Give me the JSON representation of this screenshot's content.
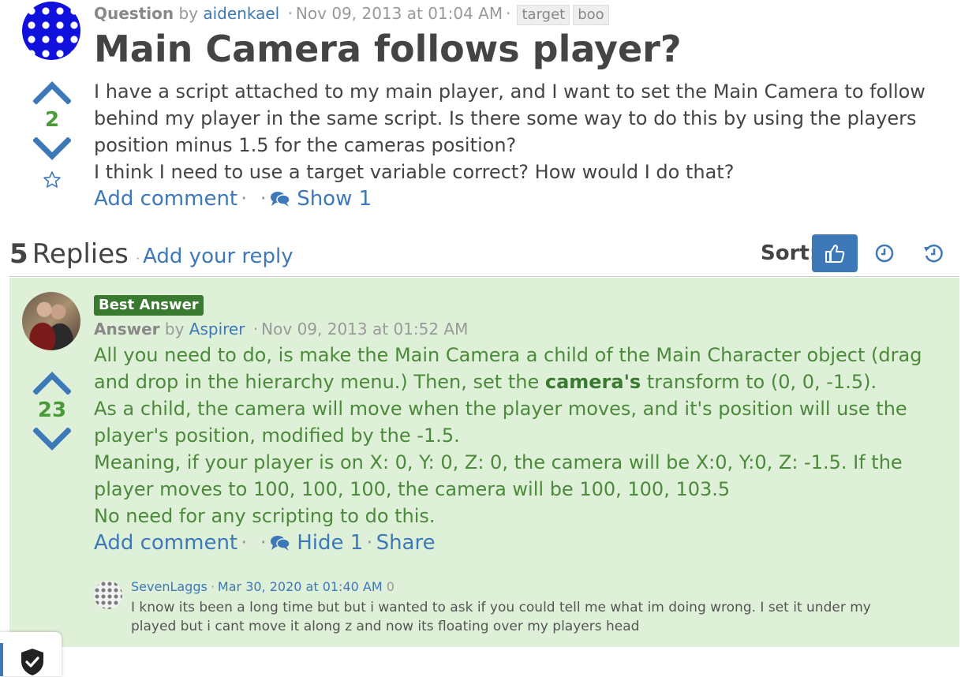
{
  "question": {
    "kind": "Question",
    "by": "by",
    "author": "aidenkael",
    "date": "Nov 09, 2013 at 01:04 AM",
    "tags": [
      "target",
      "boo"
    ],
    "title": "Main Camera follows player?",
    "score": "2",
    "body": [
      "I have a script attached to my main player, and I want to set the Main Camera to follow behind my player in the same script. Is there some way to do this by using the players position minus 1.5 for the cameras position?",
      "I think I need to use a target variable correct? How would I do that?"
    ],
    "actions": {
      "add_comment": "Add comment",
      "show_comments": "Show 1"
    }
  },
  "replies": {
    "count": "5",
    "label": "Replies",
    "add_reply": "Add your reply",
    "sort_label": "Sort:"
  },
  "answer": {
    "badge": "Best Answer",
    "kind": "Answer",
    "by": "by",
    "author": "Aspirer",
    "date": "Nov 09, 2013 at 01:52 AM",
    "score": "23",
    "body": {
      "p1_before": "All you need to do, is make the Main Camera a child of the Main Character object (drag and drop in the hierarchy menu.) Then, set the ",
      "p1_bold": "camera's",
      "p1_after": " transform to (0, 0, -1.5).",
      "p2": "As a child, the camera will move when the player moves, and it's position will use the player's position, modified by the -1.5.",
      "p3": "Meaning, if your player is on X: 0, Y: 0, Z: 0, the camera will be X:0, Y:0, Z: -1.5. If the player moves to 100, 100, 100, the camera will be 100, 100, 103.5",
      "p4": "No need for any scripting to do this."
    },
    "actions": {
      "add_comment": "Add comment",
      "hide_comments": "Hide 1",
      "share": "Share"
    },
    "comment": {
      "author": "SevenLaggs",
      "date": "Mar 30, 2020 at 01:40 AM",
      "score": "0",
      "text": "I know its been a long time but but i wanted to ask if you could tell me what im doing wrong. I set it under my played but i cant move it along z and now its floating over my players head"
    }
  },
  "colors": {
    "link": "#3d78b9",
    "answer_bg": "#dff0d8",
    "answer_text": "#4a8a3a",
    "badge_bg": "#3a7a30",
    "score_green": "#4a9a3a"
  },
  "icons": [
    "upvote-icon",
    "downvote-icon",
    "star-icon",
    "comments-icon",
    "thumbs-up-icon",
    "clock-icon",
    "history-icon",
    "shield-check-icon"
  ]
}
